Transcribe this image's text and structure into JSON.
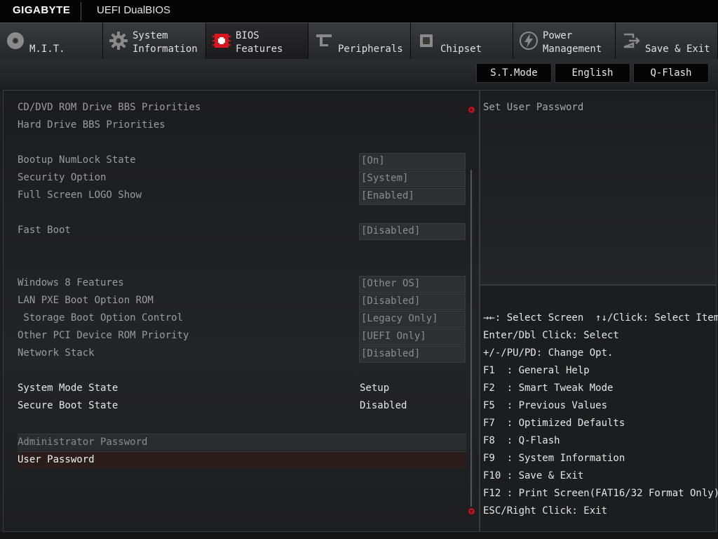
{
  "header": {
    "brand": "GIGABYTE",
    "product": "UEFI DualBIOS"
  },
  "tabs": [
    {
      "label": "M.I.T.",
      "icon": "disc-icon"
    },
    {
      "label": "System\nInformation",
      "icon": "gear-icon"
    },
    {
      "label": "BIOS\nFeatures",
      "icon": "bios-chip-icon",
      "active": true
    },
    {
      "label": "Peripherals",
      "icon": "connector-icon"
    },
    {
      "label": "Chipset",
      "icon": "chip-icon"
    },
    {
      "label": "Power\nManagement",
      "icon": "power-plug-icon"
    },
    {
      "label": "Save & Exit",
      "icon": "exit-icon"
    }
  ],
  "modebar": {
    "st_mode": "S.T.Mode",
    "language": "English",
    "qflash": "Q-Flash"
  },
  "main": {
    "cd_dvd": "CD/DVD ROM Drive BBS Priorities",
    "hard_drive": "Hard Drive BBS Priorities",
    "numlock": {
      "label": "Bootup NumLock State",
      "value": "[On]"
    },
    "security": {
      "label": "Security Option",
      "value": "[System]"
    },
    "logo": {
      "label": "Full Screen LOGO Show",
      "value": "[Enabled]"
    },
    "fastboot": {
      "label": "Fast Boot",
      "value": "[Disabled]"
    },
    "win8": {
      "label": "Windows 8 Features",
      "value": "[Other OS]"
    },
    "lanpxe": {
      "label": "LAN PXE Boot Option ROM",
      "value": "[Disabled]"
    },
    "storage": {
      "label": " Storage Boot Option Control",
      "value": "[Legacy Only]"
    },
    "otherpci": {
      "label": "Other PCI Device ROM Priority",
      "value": "[UEFI Only]"
    },
    "netstack": {
      "label": "Network Stack",
      "value": "[Disabled]"
    },
    "sysmode": {
      "label": "System Mode State",
      "value": "Setup"
    },
    "secureboot": {
      "label": "Secure Boot State",
      "value": "Disabled"
    },
    "admin_pw": "Administrator Password",
    "user_pw": "User Password"
  },
  "side": {
    "description": "Set User Password",
    "help": [
      "→←: Select Screen  ↑↓/Click: Select Item",
      "Enter/Dbl Click: Select",
      "+/-/PU/PD: Change Opt.",
      "F1  : General Help",
      "F2  : Smart Tweak Mode",
      "F5  : Previous Values",
      "F7  : Optimized Defaults",
      "F8  : Q-Flash",
      "F9  : System Information",
      "F10 : Save & Exit",
      "F12 : Print Screen(FAT16/32 Format Only)",
      "ESC/Right Click: Exit"
    ]
  },
  "colors": {
    "accent": "#c0101a",
    "selected_row": "#2a1d1b"
  }
}
